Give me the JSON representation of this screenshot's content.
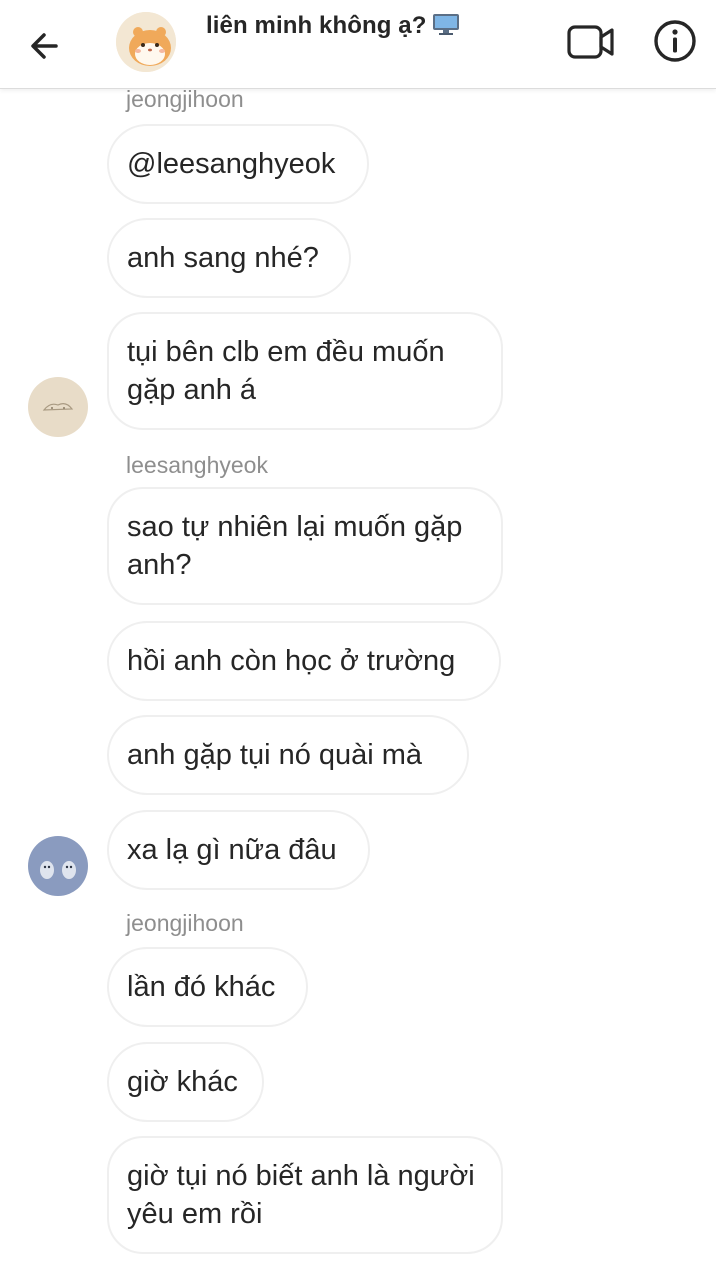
{
  "header": {
    "title": "liên minh không ạ?",
    "title_emoji": "desktop-computer-icon",
    "back_icon": "arrow-left-icon",
    "video_icon": "video-camera-icon",
    "info_icon": "info-icon",
    "avatar": "hamster-avatar"
  },
  "messages": {
    "sender_1": "jeongjihoon",
    "m1": "@leesanghyeok",
    "m2": "anh sang nhé?",
    "m3": "tụi bên clb em đều muốn gặp anh á",
    "sender_2": "leesanghyeok",
    "m4": "sao tự nhiên lại muốn gặp anh?",
    "m5": "hồi anh còn học ở trường",
    "m6": "anh gặp tụi nó quài mà",
    "m7": "xa lạ gì nữa đâu",
    "sender_3": "jeongjihoon",
    "m8": "lần đó khác",
    "m9": "giờ khác",
    "m10": "giờ tụi nó biết anh là người yêu em rồi"
  },
  "colors": {
    "text": "#262626",
    "muted": "#8e8e8e",
    "bubble_border": "#efefef",
    "avatar_beige": "#e8dcc8",
    "avatar_blue": "#8a9bbf"
  }
}
